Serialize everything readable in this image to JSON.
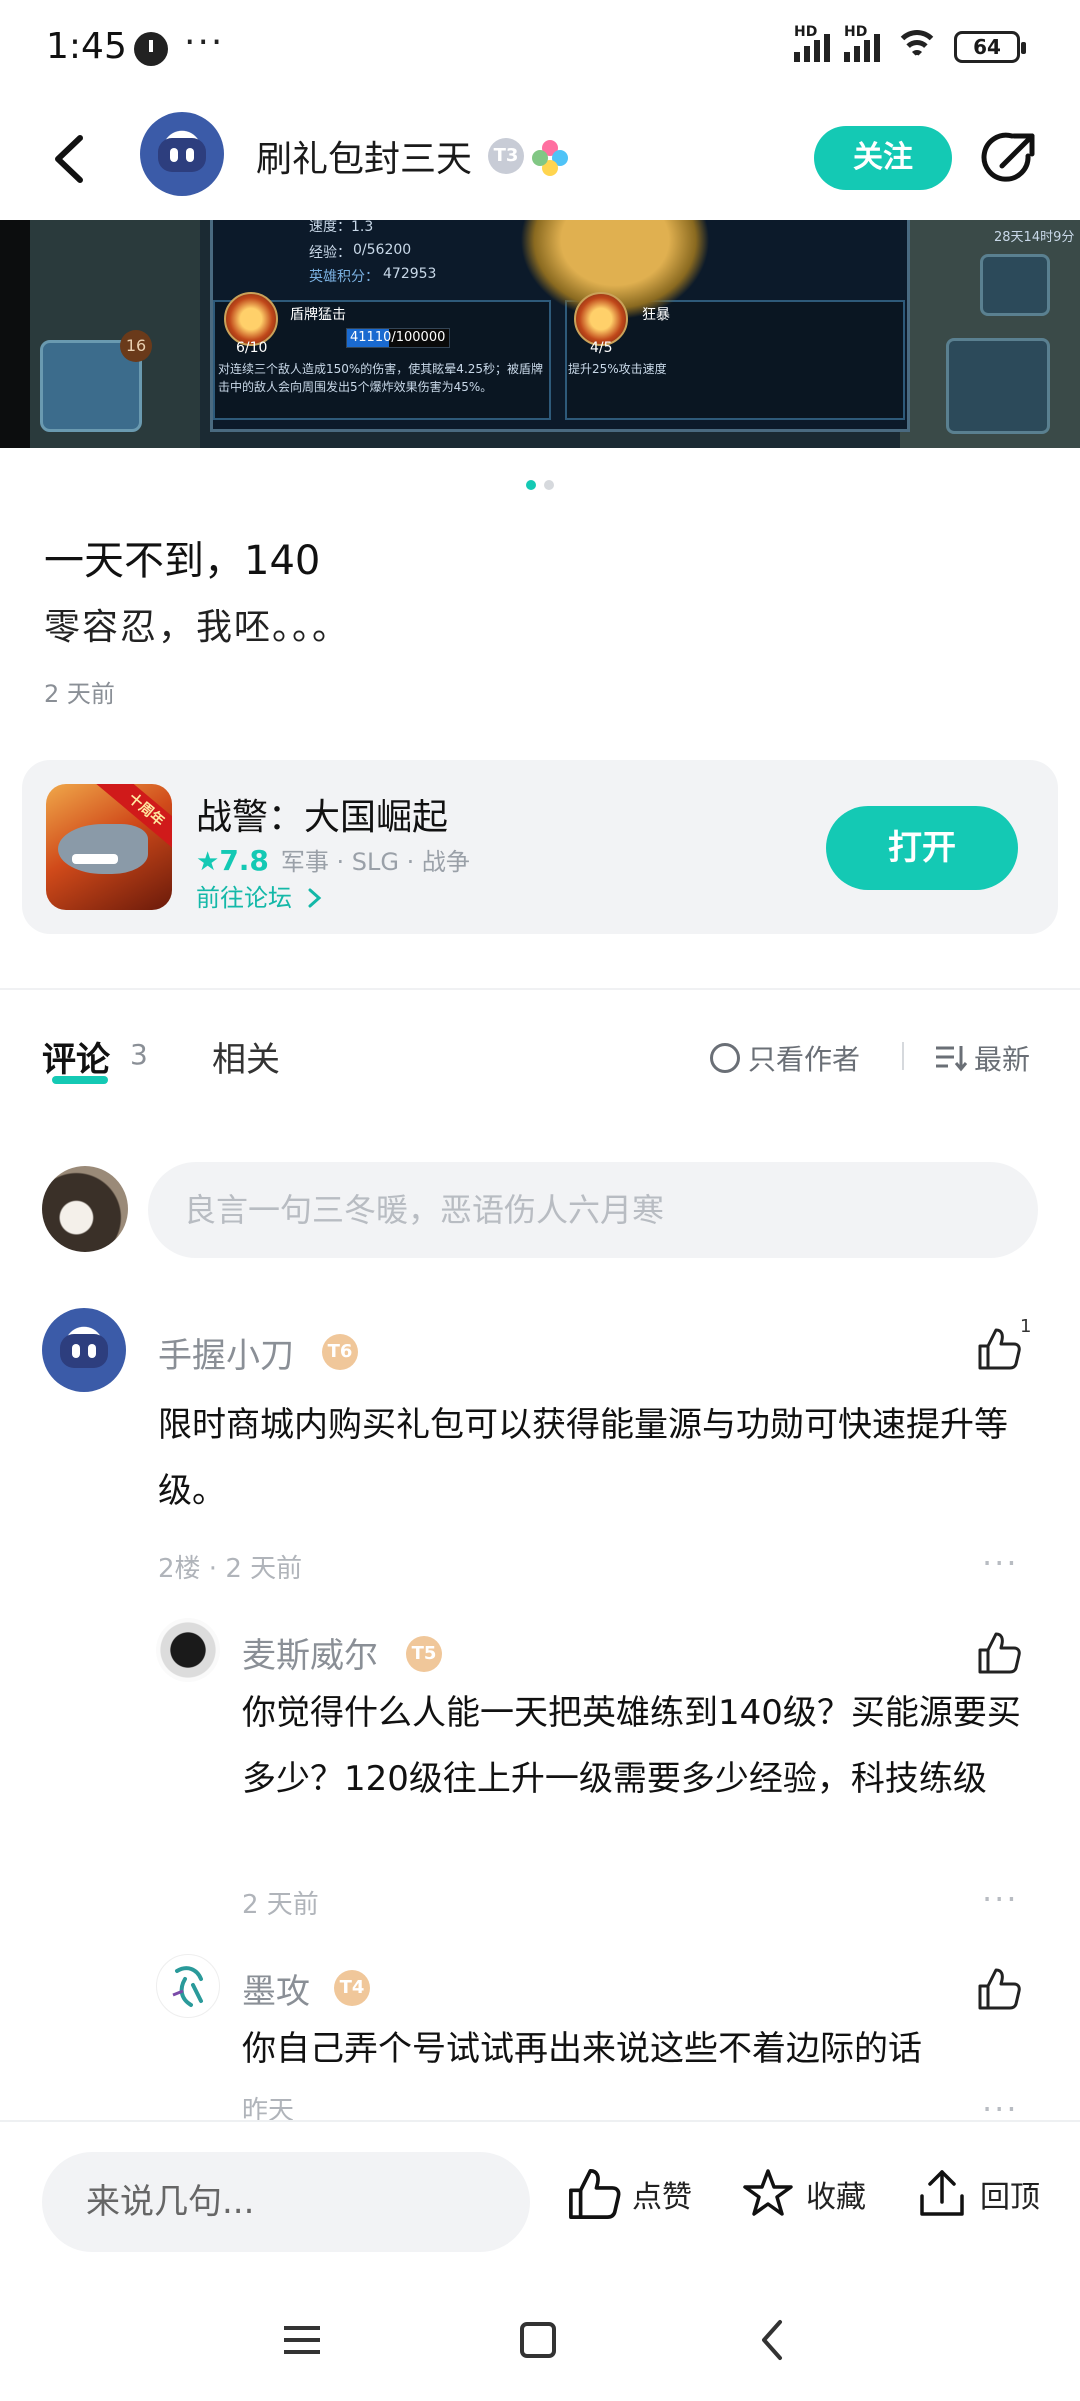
{
  "status_bar": {
    "time": "1:45",
    "more": "···",
    "battery": "64"
  },
  "header": {
    "author_name": "刷礼包封三天",
    "level_badge": "T3",
    "follow_label": "关注"
  },
  "carousel": {
    "image_text": {
      "speed_label": "速度：1.3",
      "exp_label": "经验：",
      "exp_value": "0/56200",
      "hero_points_label": "英雄积分：",
      "hero_points_value": "472953",
      "skill1_name": "盾牌猛击",
      "skill1_level": "6/10",
      "skill1_bar": "41110/100000",
      "skill1_desc": "对连续三个敌人造成150%的伤害，使其眩晕4.25秒；被盾牌",
      "skill1_desc2": "击中的敌人会向周围发出5个爆炸效果伤害为45%。",
      "skill2_name": "狂暴",
      "skill2_level": "4/5",
      "skill2_desc": "提升25%攻击速度",
      "cart_badge": "16",
      "timer": "28天14时9分"
    },
    "page_count": 2,
    "active_page": 1
  },
  "post": {
    "title": "一天不到，140",
    "body": "零容忍，我呸。。。",
    "time": "2 天前"
  },
  "game_card": {
    "ribbon": "十周年",
    "name": "战警：大国崛起",
    "score": "7.8",
    "tags": "军事 · SLG · 战争",
    "forum_link": "前往论坛",
    "open_label": "打开"
  },
  "tabs": {
    "comments_label": "评论",
    "comments_count": "3",
    "related_label": "相关",
    "filter_author": "只看作者",
    "sort_label": "最新"
  },
  "comment_input": {
    "placeholder": "良言一句三冬暖，恶语伤人六月寒"
  },
  "comments": [
    {
      "name": "手握小刀",
      "badge": "T6",
      "text": "限时商城内购买礼包可以获得能量源与功勋可快速提升等级。",
      "meta": "2楼 · 2 天前",
      "likes": "1"
    }
  ],
  "replies": [
    {
      "name": "麦斯威尔",
      "badge": "T5",
      "text": "你觉得什么人能一天把英雄练到140级？买能源要买多少？120级往上升一级需要多少经验，科技练级",
      "meta": "2 天前"
    },
    {
      "name": "墨攻",
      "badge": "T4",
      "text": "你自己弄个号试试再出来说这些不着边际的话",
      "meta": "昨天"
    }
  ],
  "bottom_bar": {
    "input_placeholder": "来说几句...",
    "like_label": "点赞",
    "favorite_label": "收藏",
    "top_label": "回顶"
  },
  "colors": {
    "accent": "#14c9b4",
    "badge_gold": "#f0c79a"
  }
}
